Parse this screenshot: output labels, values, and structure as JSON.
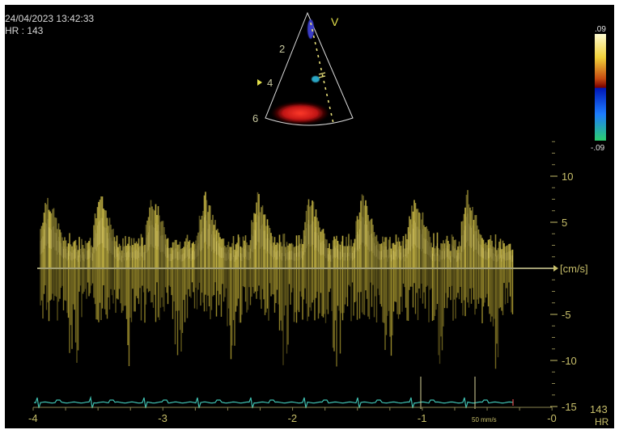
{
  "header": {
    "datetime": "24/04/2023 13:42:33",
    "heart_rate": "HR : 143"
  },
  "sector": {
    "label": "V",
    "depths": [
      "2",
      "4",
      "6"
    ]
  },
  "color_bar": {
    "top_label": ".09",
    "bottom_label": "-.09",
    "colors": [
      "#fdfbd0",
      "#f2d23a",
      "#c64a10",
      "#7a0000",
      "#0018b8",
      "#1d7cff",
      "#2bcf6e"
    ]
  },
  "velocity_scale": {
    "unit": "[cm/s]",
    "ticks": [
      "10",
      "5",
      "-5",
      "-10",
      "-15"
    ],
    "values": [
      10,
      5,
      -5,
      -10,
      -15
    ]
  },
  "time_axis": {
    "ticks": [
      "-4",
      "-3",
      "-2",
      "-1",
      "-0"
    ],
    "values": [
      -4,
      -3,
      -2,
      -1,
      0
    ],
    "sweep_speed": "50 mm/s"
  },
  "hr_readout": {
    "value": "143",
    "label": "HR"
  },
  "spectrum": {
    "beats": 9,
    "peak_velocity": 8,
    "trough_velocity": -11
  },
  "colors": {
    "spectrum": "#e9d650",
    "scale": "#c8bf6a",
    "ecg": "#3fbfb0",
    "baseline": "#d8d49a"
  }
}
